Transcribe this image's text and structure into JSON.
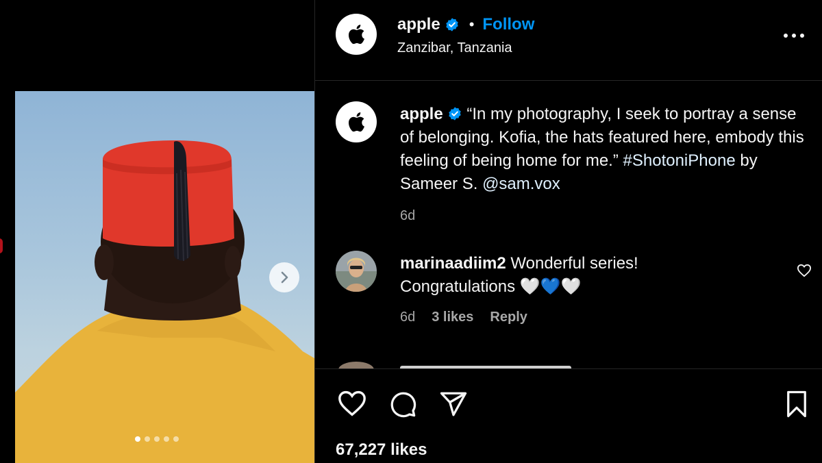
{
  "post": {
    "username": "apple",
    "follow_label": "Follow",
    "separator": "•",
    "location": "Zanzibar, Tanzania",
    "caption_user": "apple",
    "caption_body": "“In my photography, I seek to portray a sense of belonging. Kofia, the hats featured here, embody this feeling of being home for me.”",
    "hashtag": "#ShotoniPhone",
    "caption_mid": "by Sameer S.",
    "mention": "@sam.vox",
    "caption_time": "6d",
    "likes_text": "67,227 likes",
    "carousel": {
      "count": 5,
      "active_index": 0
    }
  },
  "comments": [
    {
      "username": "marinaadiim2",
      "text": "Wonderful series! Congratulations",
      "emoji": "🤍💙🤍",
      "time": "6d",
      "likes": "3 likes",
      "reply_label": "Reply"
    }
  ],
  "icons": {
    "verified": "verified-badge-icon",
    "more": "more-options-icon",
    "like": "heart-icon",
    "comment": "comment-icon",
    "share": "send-icon",
    "save": "bookmark-icon",
    "next": "chevron-right-icon"
  },
  "colors": {
    "background": "#000000",
    "accent": "#0095f6",
    "secondary_text": "#a8a8a8",
    "hat": "#e3362a",
    "jacket": "#e9b43a"
  }
}
